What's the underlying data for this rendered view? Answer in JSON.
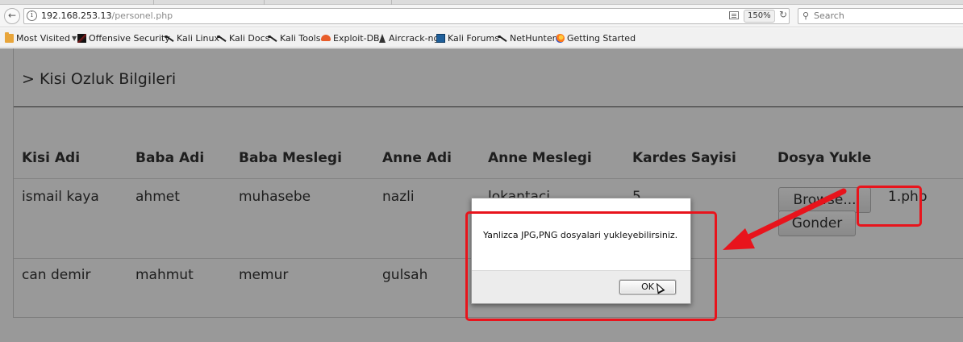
{
  "browser": {
    "url_host": "192.168.253.13",
    "url_path": "/personel.php",
    "zoom": "150%",
    "search_placeholder": "Search",
    "back_icon": "back-arrow-icon",
    "reload_icon": "reload-icon"
  },
  "bookmarks": [
    {
      "label": "Most Visited",
      "icon": "folder-icon"
    },
    {
      "label": "Offensive Security",
      "icon": "dragon-icon"
    },
    {
      "label": "Kali Linux",
      "icon": "kali-icon"
    },
    {
      "label": "Kali Docs",
      "icon": "kali-icon"
    },
    {
      "label": "Kali Tools",
      "icon": "kali-icon"
    },
    {
      "label": "Exploit-DB",
      "icon": "exploit-db-icon"
    },
    {
      "label": "Aircrack-ng",
      "icon": "aircrack-icon"
    },
    {
      "label": "Kali Forums",
      "icon": "forums-icon"
    },
    {
      "label": "NetHunter",
      "icon": "kali-icon"
    },
    {
      "label": "Getting Started",
      "icon": "firefox-icon"
    }
  ],
  "page": {
    "title": "> Kisi Ozluk Bilgileri",
    "headers": [
      "Kisi Adi",
      "Baba Adi",
      "Baba Meslegi",
      "Anne Adi",
      "Anne Meslegi",
      "Kardes Sayisi",
      "Dosya Yukle"
    ],
    "rows": [
      [
        "ismail kaya",
        "ahmet",
        "muhasebe",
        "nazli",
        "lokantaci",
        "5"
      ],
      [
        "can demir",
        "mahmut",
        "memur",
        "gulsah",
        "",
        ""
      ]
    ],
    "browse_label": "Browse...",
    "file_name": "1.php",
    "submit_label": "Gonder"
  },
  "dialog": {
    "message": "Yanlizca JPG,PNG dosyalari yukleyebilirsiniz.",
    "ok_label": "OK"
  },
  "colors": {
    "annotation": "#e8141c",
    "overlay": "rgba(0,0,0,0.40)"
  }
}
